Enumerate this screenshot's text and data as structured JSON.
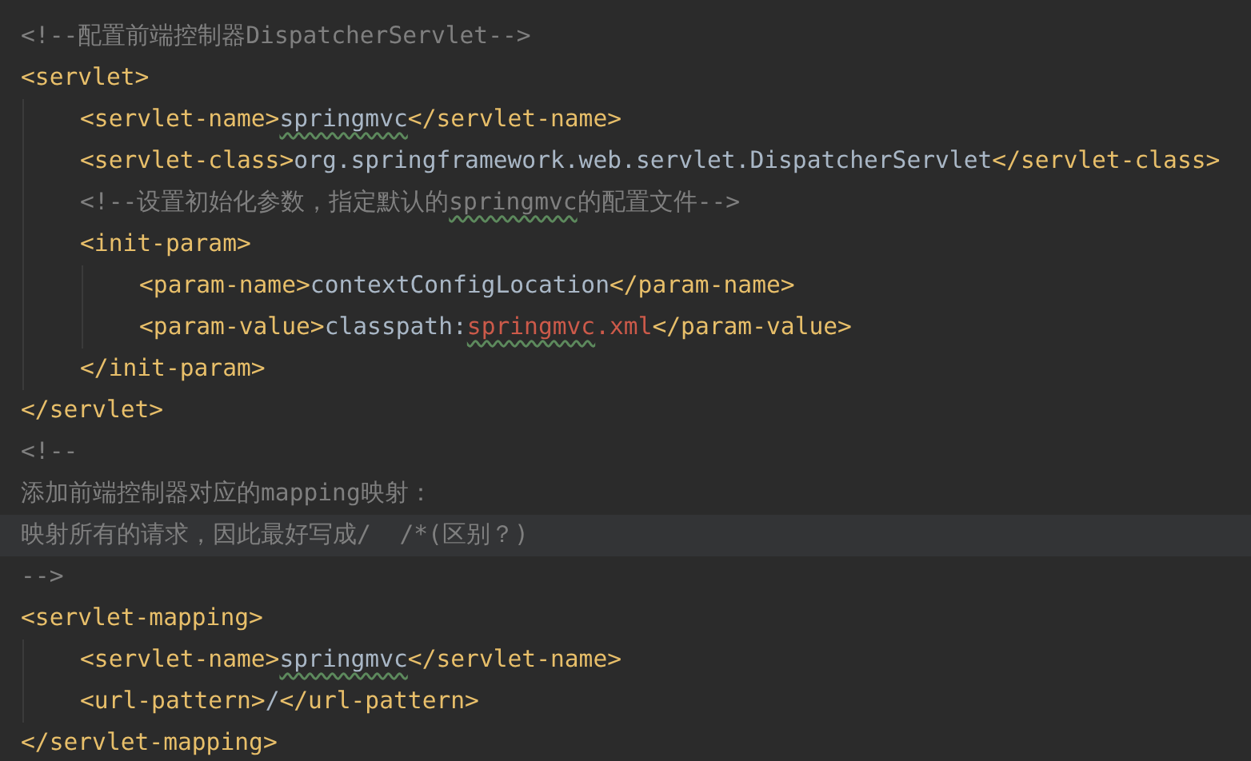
{
  "editor": {
    "lines": [
      {
        "current": false,
        "segments": [
          {
            "kind": "comment",
            "text": "<!--配置前端控制器DispatcherServlet-->"
          }
        ]
      },
      {
        "current": false,
        "segments": [
          {
            "kind": "tag",
            "text": "<servlet>"
          }
        ],
        "children": [
          {
            "current": false,
            "segments": [
              {
                "kind": "tag",
                "text": "<servlet-name>"
              },
              {
                "kind": "text-typo",
                "text": "springmvc"
              },
              {
                "kind": "tag",
                "text": "</servlet-name>"
              }
            ]
          },
          {
            "current": false,
            "segments": [
              {
                "kind": "tag",
                "text": "<servlet-class>"
              },
              {
                "kind": "text",
                "text": "org.springframework.web.servlet.DispatcherServlet"
              },
              {
                "kind": "tag",
                "text": "</servlet-class>"
              }
            ]
          },
          {
            "current": false,
            "segments": [
              {
                "kind": "comment",
                "text": "<!--设置初始化参数，指定默认的"
              },
              {
                "kind": "comment-typo",
                "text": "springmvc"
              },
              {
                "kind": "comment",
                "text": "的配置文件-->"
              }
            ]
          },
          {
            "current": false,
            "segments": [
              {
                "kind": "tag",
                "text": "<init-param>"
              }
            ],
            "children": [
              {
                "current": false,
                "segments": [
                  {
                    "kind": "tag",
                    "text": "<param-name>"
                  },
                  {
                    "kind": "text",
                    "text": "contextConfigLocation"
                  },
                  {
                    "kind": "tag",
                    "text": "</param-name>"
                  }
                ]
              },
              {
                "current": false,
                "segments": [
                  {
                    "kind": "tag",
                    "text": "<param-value>"
                  },
                  {
                    "kind": "text",
                    "text": "classpath:"
                  },
                  {
                    "kind": "value-typo",
                    "text": "springmvc"
                  },
                  {
                    "kind": "value",
                    "text": ".xml"
                  },
                  {
                    "kind": "tag",
                    "text": "</param-value>"
                  }
                ]
              }
            ]
          },
          {
            "current": false,
            "segments": [
              {
                "kind": "tag",
                "text": "</init-param>"
              }
            ]
          }
        ]
      },
      {
        "current": false,
        "segments": [
          {
            "kind": "tag",
            "text": "</servlet>"
          }
        ]
      },
      {
        "current": false,
        "segments": [
          {
            "kind": "comment",
            "text": "<!--"
          }
        ]
      },
      {
        "current": false,
        "segments": [
          {
            "kind": "comment",
            "text": "添加前端控制器对应的mapping映射："
          }
        ]
      },
      {
        "current": true,
        "segments": [
          {
            "kind": "comment",
            "text": "映射所有的请求，因此最好写成/  /*(区别？)"
          }
        ]
      },
      {
        "current": false,
        "segments": [
          {
            "kind": "comment",
            "text": "-->"
          }
        ]
      },
      {
        "current": false,
        "segments": [
          {
            "kind": "tag",
            "text": "<servlet-mapping>"
          }
        ],
        "children": [
          {
            "current": false,
            "segments": [
              {
                "kind": "tag",
                "text": "<servlet-name>"
              },
              {
                "kind": "text-typo",
                "text": "springmvc"
              },
              {
                "kind": "tag",
                "text": "</servlet-name>"
              }
            ]
          },
          {
            "current": false,
            "segments": [
              {
                "kind": "tag",
                "text": "<url-pattern>"
              },
              {
                "kind": "text",
                "text": "/"
              },
              {
                "kind": "tag",
                "text": "</url-pattern>"
              }
            ]
          }
        ]
      },
      {
        "current": false,
        "segments": [
          {
            "kind": "tag",
            "text": "</servlet-mapping>"
          }
        ]
      }
    ]
  }
}
